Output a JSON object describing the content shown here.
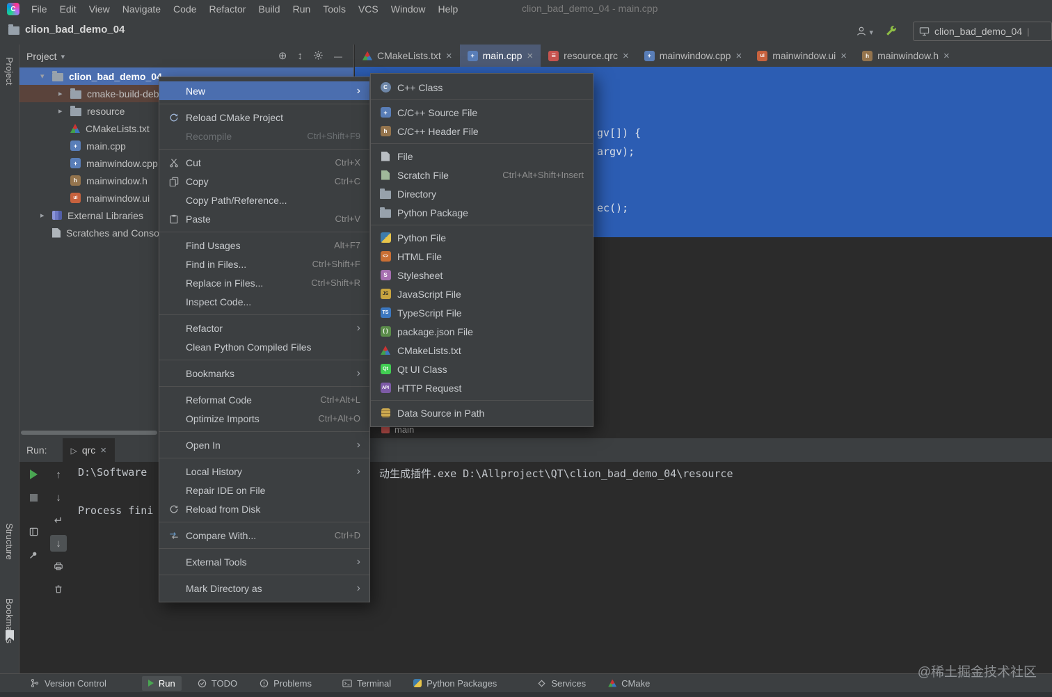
{
  "colors": {
    "accent": "#4b6eaf",
    "editor_selection": "#2c5db3",
    "excluded_row": "#5a433b",
    "panel": "#3c3f41",
    "editor": "#2b2b2b",
    "border": "#515151",
    "tab_active": "#4d5a74",
    "green": "#4aa652",
    "red": "#c75450"
  },
  "menubar": {
    "items": [
      "File",
      "Edit",
      "View",
      "Navigate",
      "Code",
      "Refactor",
      "Build",
      "Run",
      "Tools",
      "VCS",
      "Window",
      "Help"
    ],
    "window_title": "clion_bad_demo_04 - main.cpp"
  },
  "header": {
    "project_name": "clion_bad_demo_04",
    "run_config_name": "clion_bad_demo_04"
  },
  "tool_window_stripe": {
    "top": "Project",
    "middle": "Structure",
    "bottom": "Bookmarks"
  },
  "project_panel": {
    "title": "Project",
    "tree": [
      {
        "label": "clion_bad_demo_04",
        "icon": "folder-icon",
        "state": "expanded",
        "selected": true
      },
      {
        "label": "cmake-build-debug",
        "icon": "folder-icon",
        "state": "collapsed",
        "highlight": "excluded"
      },
      {
        "label": "resource",
        "icon": "folder-icon",
        "state": "collapsed"
      },
      {
        "label": "CMakeLists.txt",
        "icon": "cmake-file-icon"
      },
      {
        "label": "main.cpp",
        "icon": "cpp-file-icon"
      },
      {
        "label": "mainwindow.cpp",
        "icon": "cpp-file-icon"
      },
      {
        "label": "mainwindow.h",
        "icon": "header-file-icon"
      },
      {
        "label": "mainwindow.ui",
        "icon": "ui-file-icon"
      },
      {
        "label": "External Libraries",
        "icon": "library-icon",
        "state": "collapsed"
      },
      {
        "label": "Scratches and Consoles",
        "icon": "scratches-icon"
      }
    ]
  },
  "editor_tabs": [
    {
      "label": "CMakeLists.txt",
      "icon": "cmake-file-icon",
      "active": false
    },
    {
      "label": "main.cpp",
      "icon": "cpp-file-icon",
      "active": true
    },
    {
      "label": "resource.qrc",
      "icon": "qrc-file-icon",
      "active": false
    },
    {
      "label": "mainwindow.cpp",
      "icon": "cpp-file-icon",
      "active": false
    },
    {
      "label": "mainwindow.ui",
      "icon": "ui-file-icon",
      "active": false
    },
    {
      "label": "mainwindow.h",
      "icon": "header-file-icon",
      "active": false
    }
  ],
  "editor": {
    "code_fragments": [
      "gv[]) {",
      "argv);",
      "ec();"
    ],
    "breadcrumb": "main"
  },
  "context_menu": {
    "items": [
      {
        "label": "New",
        "submenu": true,
        "selected": true
      },
      {
        "label": "Reload CMake Project",
        "icon": "reload-icon"
      },
      {
        "label": "Recompile",
        "shortcut": "Ctrl+Shift+F9",
        "enabled": false
      },
      {
        "label": "Cut",
        "icon": "cut-icon",
        "shortcut": "Ctrl+X"
      },
      {
        "label": "Copy",
        "icon": "copy-icon",
        "shortcut": "Ctrl+C"
      },
      {
        "label": "Copy Path/Reference..."
      },
      {
        "label": "Paste",
        "icon": "paste-icon",
        "shortcut": "Ctrl+V"
      },
      {
        "label": "Find Usages",
        "shortcut": "Alt+F7"
      },
      {
        "label": "Find in Files...",
        "shortcut": "Ctrl+Shift+F"
      },
      {
        "label": "Replace in Files...",
        "shortcut": "Ctrl+Shift+R"
      },
      {
        "label": "Inspect Code..."
      },
      {
        "label": "Refactor",
        "submenu": true
      },
      {
        "label": "Clean Python Compiled Files"
      },
      {
        "label": "Bookmarks",
        "submenu": true
      },
      {
        "label": "Reformat Code",
        "shortcut": "Ctrl+Alt+L"
      },
      {
        "label": "Optimize Imports",
        "shortcut": "Ctrl+Alt+O"
      },
      {
        "label": "Open In",
        "submenu": true
      },
      {
        "label": "Local History",
        "submenu": true
      },
      {
        "label": "Repair IDE on File"
      },
      {
        "label": "Reload from Disk",
        "icon": "reload-icon"
      },
      {
        "label": "Compare With...",
        "icon": "compare-icon",
        "shortcut": "Ctrl+D"
      },
      {
        "label": "External Tools",
        "submenu": true
      },
      {
        "label": "Mark Directory as",
        "submenu": true
      }
    ]
  },
  "new_submenu": {
    "items": [
      {
        "label": "C++ Class",
        "icon": "cpp-class-icon"
      },
      {
        "label": "C/C++ Source File",
        "icon": "cpp-source-file-icon"
      },
      {
        "label": "C/C++ Header File",
        "icon": "cpp-header-file-icon"
      },
      {
        "label": "File",
        "icon": "file-icon"
      },
      {
        "label": "Scratch File",
        "icon": "scratch-file-icon",
        "shortcut": "Ctrl+Alt+Shift+Insert"
      },
      {
        "label": "Directory",
        "icon": "directory-icon"
      },
      {
        "label": "Python Package",
        "icon": "python-package-icon"
      },
      {
        "label": "Python File",
        "icon": "python-file-icon"
      },
      {
        "label": "HTML File",
        "icon": "html-file-icon"
      },
      {
        "label": "Stylesheet",
        "icon": "stylesheet-icon"
      },
      {
        "label": "JavaScript File",
        "icon": "javascript-file-icon"
      },
      {
        "label": "TypeScript File",
        "icon": "typescript-file-icon"
      },
      {
        "label": "package.json File",
        "icon": "package-json-icon"
      },
      {
        "label": "CMakeLists.txt",
        "icon": "cmake-file-icon"
      },
      {
        "label": "Qt UI Class",
        "icon": "qt-ui-icon"
      },
      {
        "label": "HTTP Request",
        "icon": "http-request-icon"
      },
      {
        "label": "Data Source in Path",
        "icon": "data-source-icon"
      }
    ]
  },
  "run_panel": {
    "title": "Run:",
    "tab_label": "qrc",
    "console": {
      "line1_left": "D:\\Software",
      "line1_right": "动生成插件.exe D:\\Allproject\\QT\\clion_bad_demo_04\\resource",
      "line2": "Process fini"
    }
  },
  "status_bar": {
    "items": [
      {
        "label": "Version Control",
        "icon": "branch-icon"
      },
      {
        "label": "Run",
        "icon": "run-icon",
        "active": true
      },
      {
        "label": "TODO",
        "icon": "todo-icon"
      },
      {
        "label": "Problems",
        "icon": "problems-icon"
      },
      {
        "label": "Terminal",
        "icon": "terminal-icon"
      },
      {
        "label": "Python Packages",
        "icon": "python-icon"
      },
      {
        "label": "Services",
        "icon": "services-icon"
      },
      {
        "label": "CMake",
        "icon": "cmake-icon"
      }
    ]
  },
  "watermark": "@稀土掘金技术社区"
}
